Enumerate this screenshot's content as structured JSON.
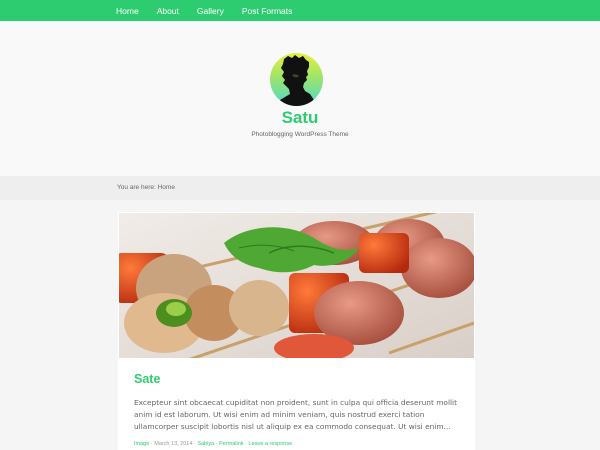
{
  "nav": {
    "items": [
      "Home",
      "About",
      "Gallery",
      "Post Formats"
    ]
  },
  "header": {
    "title": "Satu",
    "description": "Photoblogging WordPress Theme",
    "logo_icon": "silhouette-portrait-icon"
  },
  "breadcrumb": {
    "text": "You are here: Home"
  },
  "post": {
    "image_icon": "food-skewers-photo",
    "title": "Sate",
    "excerpt": "Excepteur sint obcaecat cupiditat non proident, sunt in culpa qui officia deserunt mollit anim id est laborum. Ut wisi enim ad minim veniam, quis nostrud exerci tation ullamcorper suscipit lobortis nisl ut aliquip ex ea commodo consequat. Ut wisi enim…",
    "meta": {
      "format": "Image",
      "date": "March 13, 2014",
      "author": "Sabiya",
      "permalink": "Permalink",
      "comments": "Leave a response"
    }
  },
  "colors": {
    "accent": "#2ecc71",
    "page_background": "#f5f5f5"
  }
}
